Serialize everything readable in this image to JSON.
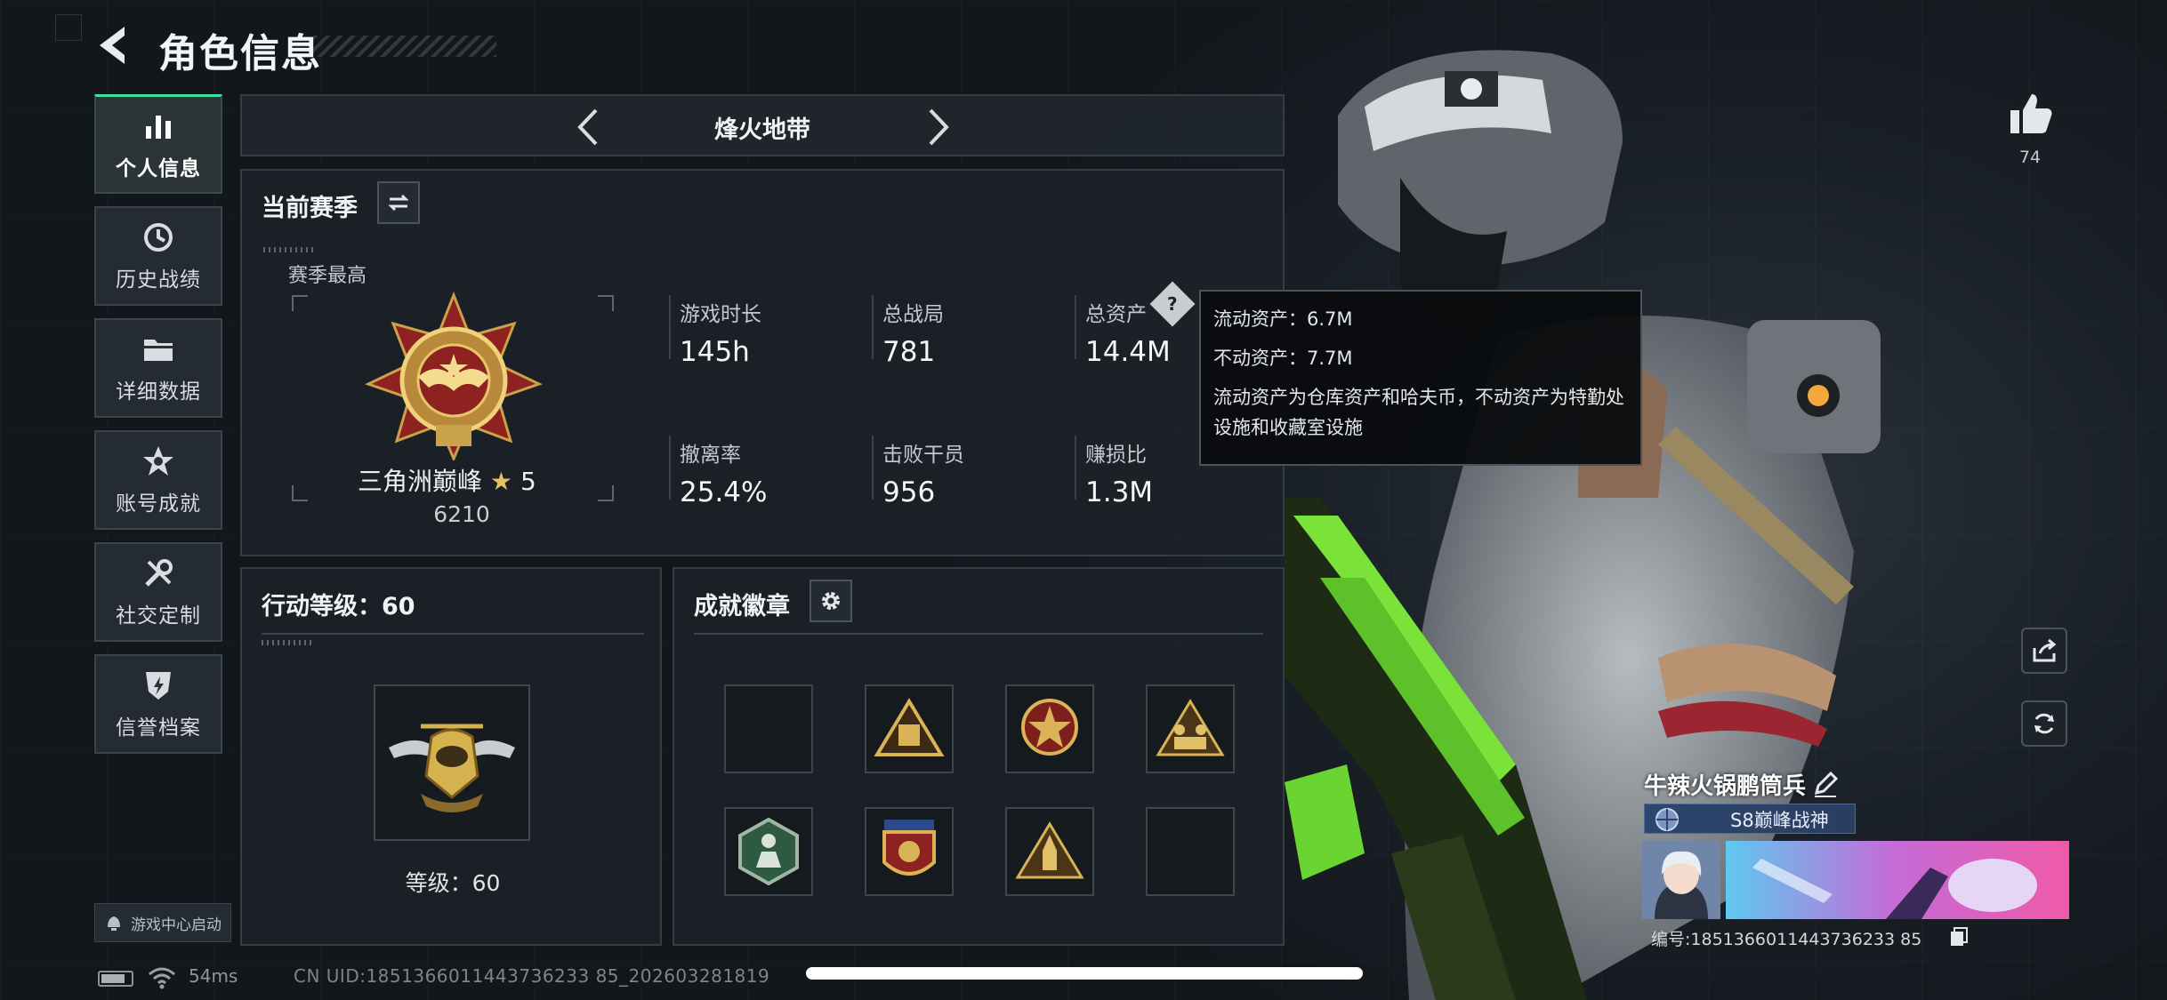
{
  "header": {
    "title": "角色信息"
  },
  "sidebar": {
    "items": [
      {
        "label": "个人信息",
        "icon": "bar-chart-icon",
        "active": true
      },
      {
        "label": "历史战绩",
        "icon": "history-clock-icon",
        "active": false
      },
      {
        "label": "详细数据",
        "icon": "folder-icon",
        "active": false
      },
      {
        "label": "账号成就",
        "icon": "achievement-star-icon",
        "active": false
      },
      {
        "label": "社交定制",
        "icon": "tools-icon",
        "active": false
      },
      {
        "label": "信誉档案",
        "icon": "shield-lightning-icon",
        "active": false
      }
    ],
    "game_center": "游戏中心启动"
  },
  "mode_bar": {
    "title": "烽火地带"
  },
  "season": {
    "title": "当前赛季",
    "best_label": "赛季最高",
    "rank_name": "三角洲巅峰",
    "rank_stars": "5",
    "rank_points": "6210",
    "stats": [
      {
        "label": "游戏时长",
        "value": "145h"
      },
      {
        "label": "总战局",
        "value": "781"
      },
      {
        "label": "总资产",
        "value": "14.4M"
      },
      {
        "label": "撤离率",
        "value": "25.4%"
      },
      {
        "label": "击败干员",
        "value": "956"
      },
      {
        "label": "赚损比",
        "value": "1.3M"
      }
    ],
    "help_glyph": "?"
  },
  "tooltip": {
    "line1": "流动资产：6.7M",
    "line2": "不动资产：7.7M",
    "line3": "流动资产为仓库资产和哈夫币，不动资产为特勤处设施和收藏室设施"
  },
  "action_level": {
    "title": "行动等级：60",
    "level_text": "等级：60"
  },
  "badges": {
    "title": "成就徽章",
    "slots": [
      {
        "icon": "empty-slot"
      },
      {
        "icon": "gold-triangle-badge-icon"
      },
      {
        "icon": "star-round-badge-icon"
      },
      {
        "icon": "soldiers-triangle-badge-icon"
      },
      {
        "icon": "green-hexagon-badge-icon"
      },
      {
        "icon": "shield-crest-badge-icon"
      },
      {
        "icon": "rocket-triangle-badge-icon"
      },
      {
        "icon": "empty-slot"
      }
    ]
  },
  "profile": {
    "likes": "74",
    "player_name": "牛辣火锅鹏筒兵",
    "title_tag": "S8巅峰战神",
    "id_label": "编号:1851366011443736233 85"
  },
  "status_bar": {
    "latency": "54ms",
    "cn_uid": "CN UID:1851366011443736233 85_202603281819"
  },
  "colors": {
    "accent_green": "#3fe1a2",
    "gold": "#c9a24a",
    "panel_bg": "#1c2228"
  }
}
